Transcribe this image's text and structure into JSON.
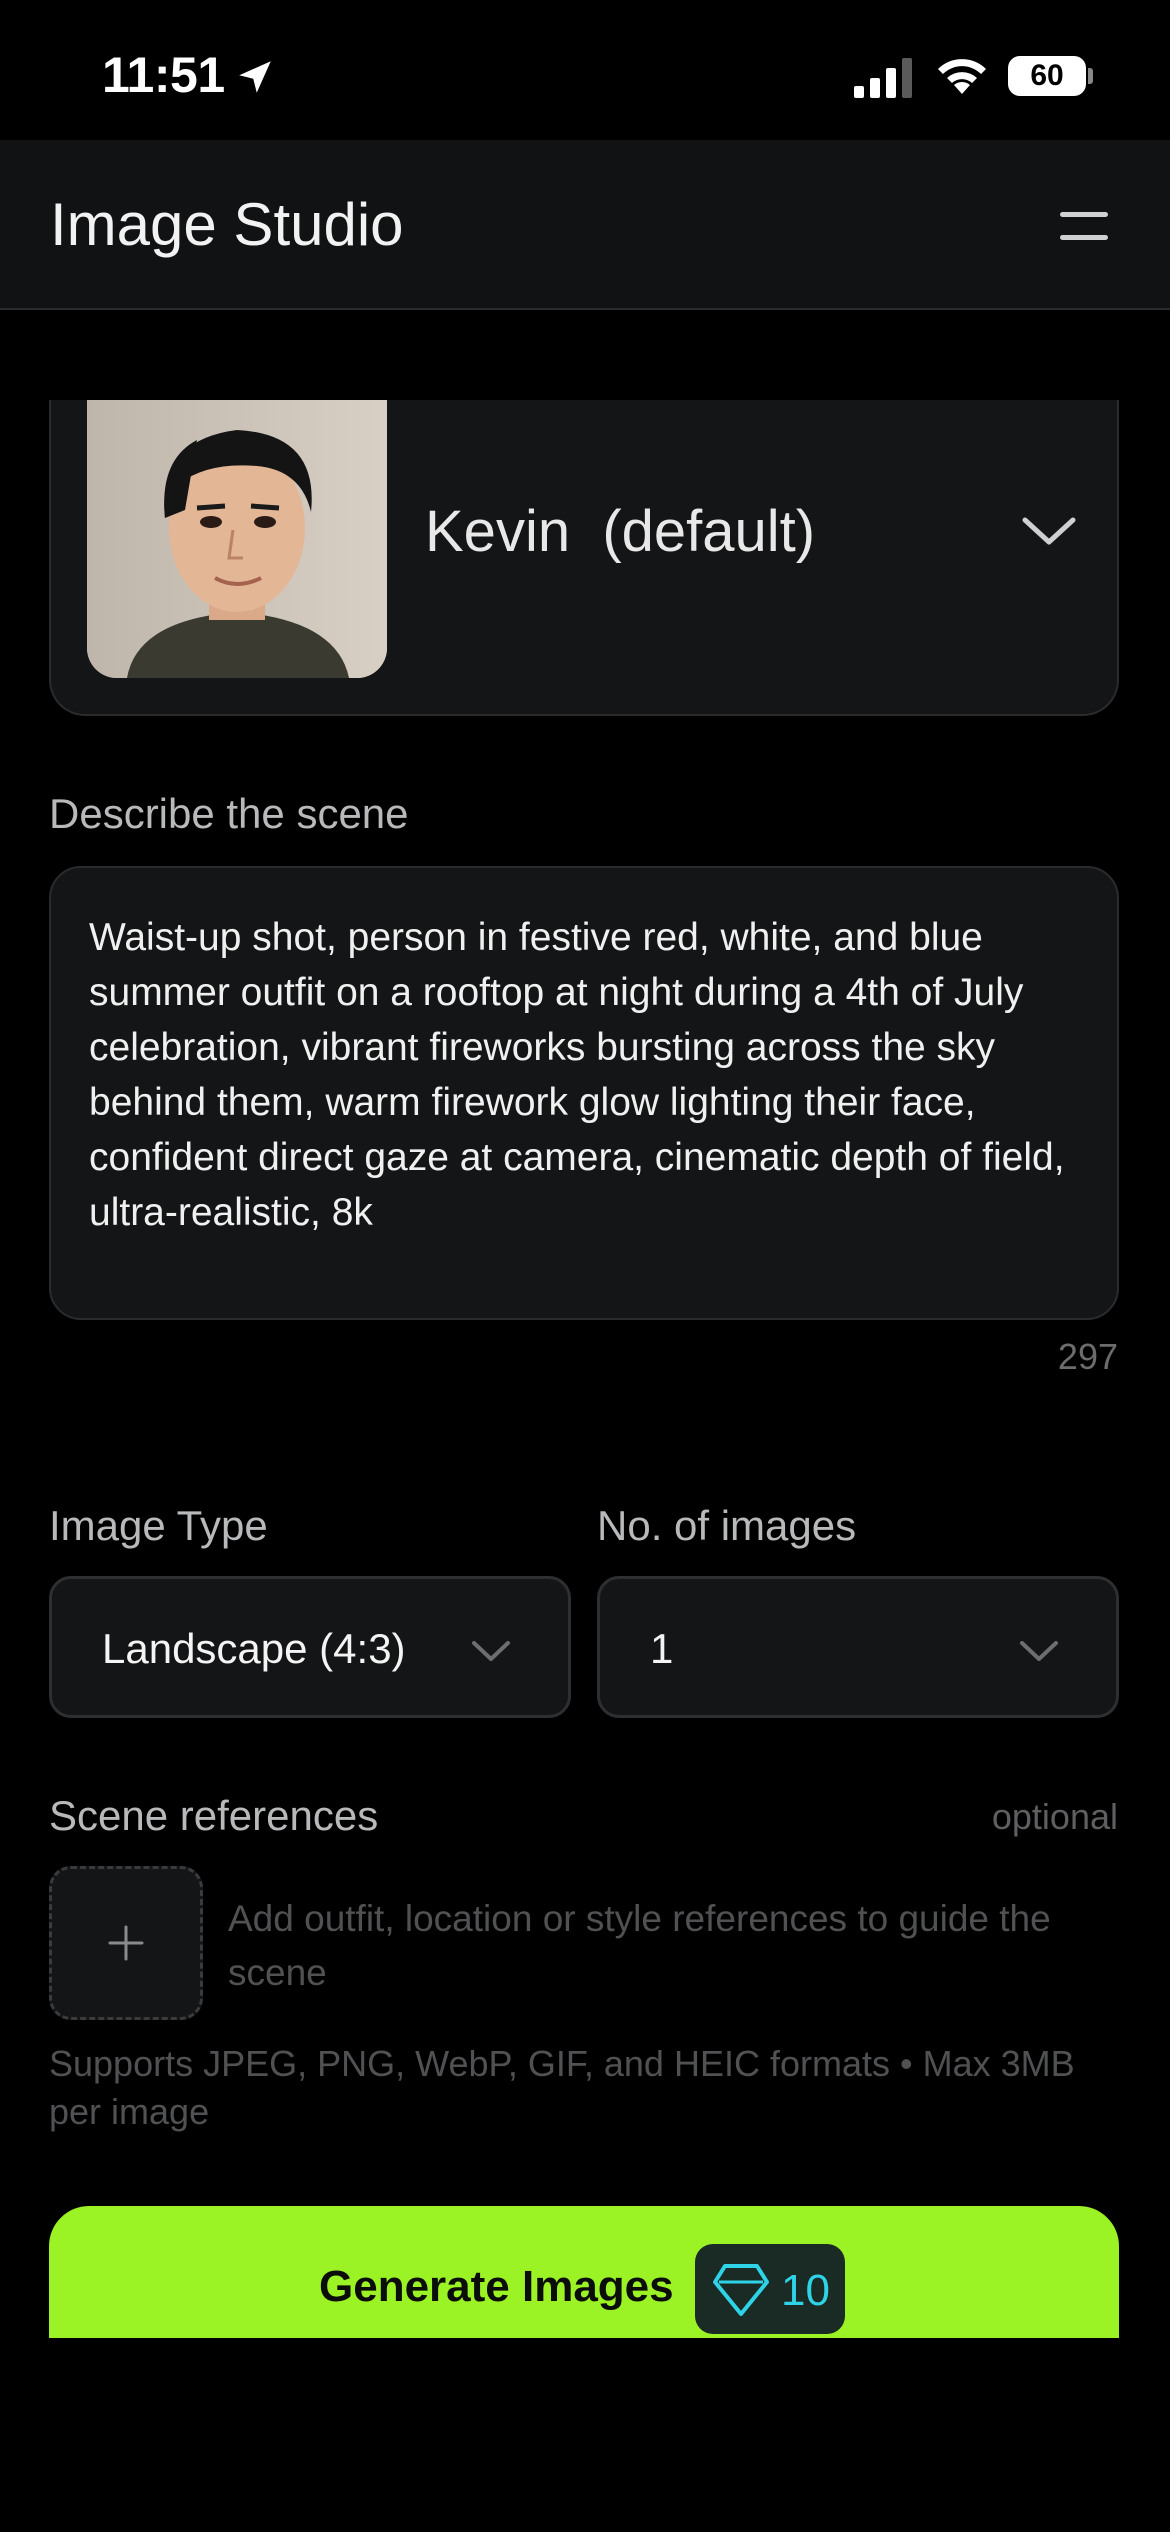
{
  "status_bar": {
    "time": "11:51",
    "battery": "60",
    "icons": [
      "location-arrow-icon",
      "cellular-signal-icon",
      "wifi-icon",
      "battery-icon"
    ]
  },
  "header": {
    "title": "Image Studio",
    "menu_icon": "hamburger-menu-icon"
  },
  "profile": {
    "name": "Kevin  (default)",
    "dropdown_icon": "chevron-down-icon"
  },
  "scene": {
    "label": "Describe the scene",
    "text": "Waist-up shot, person in festive red, white, and blue summer outfit on a rooftop at night during a 4th of July celebration, vibrant fireworks bursting across the sky behind them, warm firework glow lighting their face, confident direct gaze at camera, cinematic depth of field, ultra-realistic, 8k",
    "char_count": "297"
  },
  "image_type": {
    "label": "Image Type",
    "value": "Landscape (4:3)"
  },
  "num_images": {
    "label": "No. of images",
    "value": "1"
  },
  "references": {
    "label": "Scene references",
    "optional": "optional",
    "hint": "Add outfit, location or style references to guide the scene",
    "formats": "Supports JPEG, PNG, WebP, GIF, and HEIC formats • Max 3MB per image"
  },
  "generate": {
    "label": "Generate Images",
    "cost": "10"
  },
  "colors": {
    "accent": "#9bf224",
    "gem": "#2fd3e8",
    "background": "#000000",
    "surface": "#141516"
  }
}
